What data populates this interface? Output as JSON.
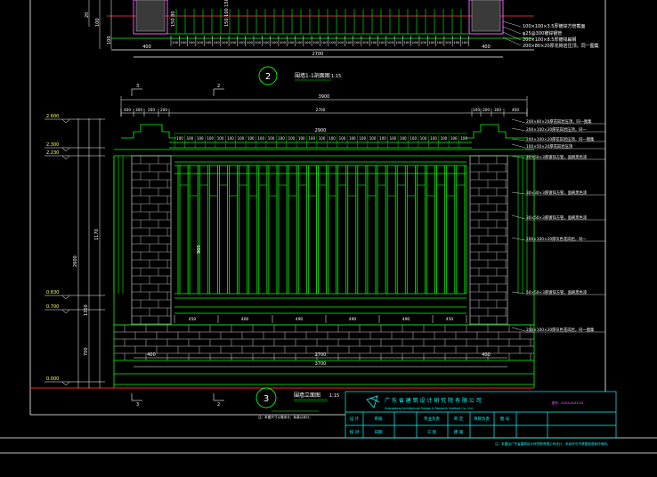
{
  "palette": {
    "background": "#000000",
    "structure": "#00ff00",
    "dimension": "#ffffff",
    "note_text": "#ffffff",
    "title_block": "#00ffff",
    "pillar_hatch": "#b0b0b0",
    "ground_line": "#ff2020",
    "marker": "#ffff00"
  },
  "section_2": {
    "number": "2",
    "title": "围墙1-1剖面图",
    "scale": "1:15",
    "overall_dim": "2700",
    "side_dims": [
      "400",
      "400"
    ],
    "notes": [
      "100×100×3.5厚镀锌方管截面",
      "φ25@300镀锌钢管",
      "200×100×8.5厚镀锌扁钢",
      "200×80×20厚花岗岩压顶，同一图集"
    ]
  },
  "elevation_3": {
    "number": "3",
    "title": "围墙立面图",
    "scale": "1:15",
    "section_marks": [
      "3",
      "2",
      "3",
      "2"
    ],
    "top_overall": "3900",
    "top_segments": [
      "400",
      "300",
      "200",
      "200",
      "2700",
      "100",
      "200",
      "300",
      "400"
    ],
    "inner_dim": "2900",
    "baluster_spacing": "100",
    "bottom_segments": [
      "450",
      "400",
      "490",
      "490",
      "490",
      "450"
    ],
    "base_dims": [
      "400",
      "2700",
      "400"
    ],
    "base_overall": "3700",
    "elevation_marks": [
      "2.600",
      "2.300",
      "2.230",
      "0.830",
      "0.700",
      "0.000"
    ],
    "vertical_dims": [
      "2600",
      "700",
      "1350",
      "1170",
      "960"
    ],
    "notes": [
      "200×80×20厚花岗岩压顶，同一图集",
      "200×100×20厚花岗岩压顶，同一",
      "200×100×20厚花岗岩压顶，同一图集",
      "100×50×20厚花岗岩压顶",
      "30×50×3厚镀锌方管，面刷黑色漆",
      "30×30×3厚镀锌方管，面刷黑色漆",
      "30×50×3厚镀锌方管，面刷黑色漆",
      "200×100×20厚灰色花岗岩，同一",
      "50×50×3厚镀锌方管，面刷黑色漆",
      "200×100×20厚灰色花岗岩，同一图集"
    ],
    "footnote": "注：本图尺寸以毫米计，标高以米计。"
  },
  "title_block": {
    "institute_name": "广 东 省 建 筑 设 计 研 究 院 有 限 公 司",
    "institute_name_en": "Guangdong Architectural Design & Research Institute Co., Ltd.",
    "project_code": "图号：XXXX-XXXX-XX",
    "cells": [
      "设 计",
      "审核",
      "专业负责",
      "审 定",
      "项目负责",
      "图 号",
      "校 对",
      "日期",
      "工 程",
      "建 施"
    ],
    "bottom_note": "注：本图由广东省建筑设计研究院有限公司设计，未经许可不得复制或转作他用。"
  }
}
